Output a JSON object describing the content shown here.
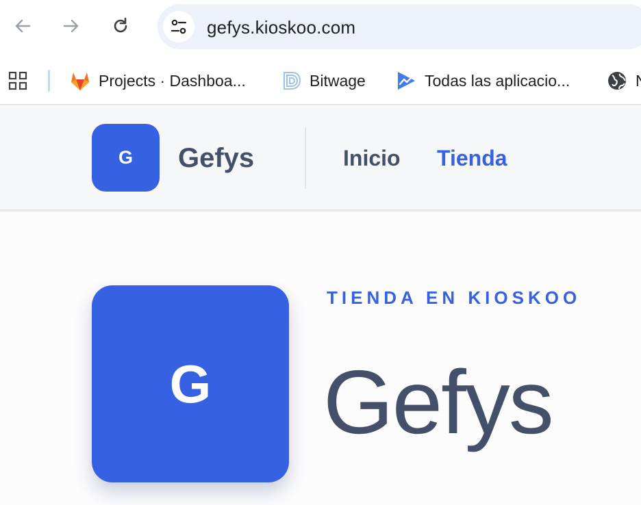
{
  "browser": {
    "url": "gefys.kioskoo.com",
    "icons": {
      "back": "arrow-left-icon",
      "forward": "arrow-right-icon",
      "reload": "reload-icon",
      "site_info": "tune-icon"
    }
  },
  "bookmarks": {
    "items": [
      {
        "label": "Projects · Dashboa...",
        "icon": "gitlab-icon"
      },
      {
        "label": "Bitwage",
        "icon": "bitwage-icon"
      },
      {
        "label": "Todas las aplicacio...",
        "icon": "apps-arrow-icon"
      },
      {
        "label": "N",
        "icon": "globe-icon"
      }
    ]
  },
  "header": {
    "logo_letter": "G",
    "brand_name": "Gefys",
    "nav": [
      {
        "label": "Inicio",
        "active": false
      },
      {
        "label": "Tienda",
        "active": true
      }
    ]
  },
  "hero": {
    "logo_letter": "G",
    "eyebrow": "TIENDA EN KIOSKOO",
    "title": "Gefys"
  },
  "colors": {
    "accent": "#3661e3",
    "text_dark": "#44506a",
    "header_bg": "#f6f7f9"
  }
}
